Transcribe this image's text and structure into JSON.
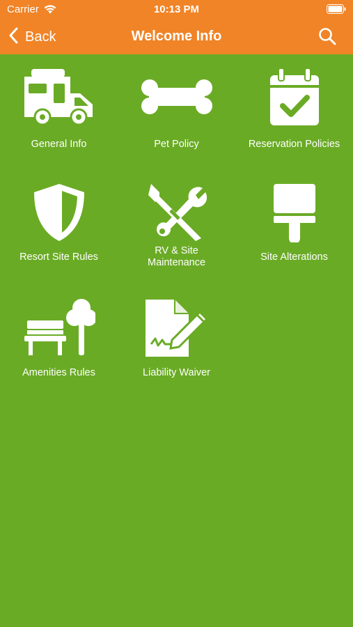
{
  "status_bar": {
    "carrier": "Carrier",
    "time": "10:13 PM"
  },
  "nav": {
    "back_label": "Back",
    "title": "Welcome Info"
  },
  "tiles": [
    {
      "label": "General Info",
      "icon": "rv-camper-icon"
    },
    {
      "label": "Pet Policy",
      "icon": "bone-icon"
    },
    {
      "label": "Reservation Policies",
      "icon": "calendar-check-icon"
    },
    {
      "label": "Resort Site Rules",
      "icon": "shield-icon"
    },
    {
      "label_line1": "RV & Site",
      "label_line2": "Maintenance",
      "icon": "tools-icon"
    },
    {
      "label": "Site Alterations",
      "icon": "paint-brush-icon"
    },
    {
      "label": "Amenities Rules",
      "icon": "park-bench-tree-icon"
    },
    {
      "label": "Liability Waiver",
      "icon": "signed-document-icon"
    }
  ],
  "colors": {
    "header": "#f08427",
    "background": "#6aab25",
    "foreground": "#ffffff"
  }
}
